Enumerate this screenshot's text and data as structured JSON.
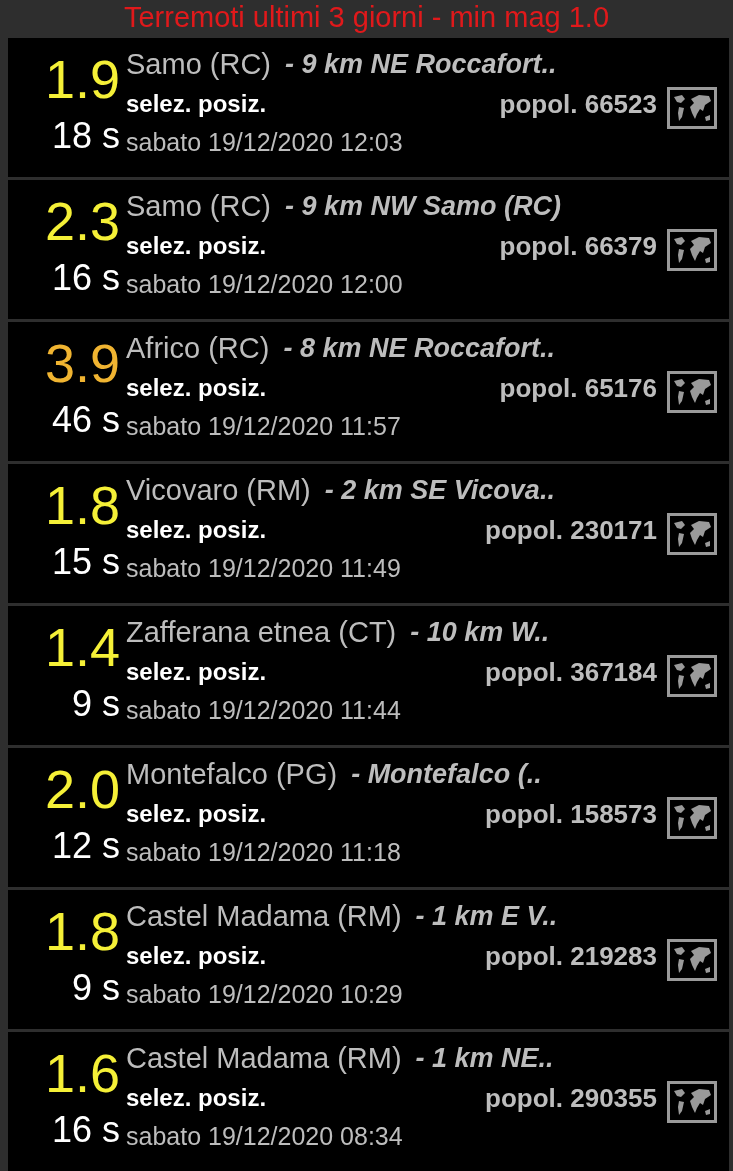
{
  "title": "Terremoti ultimi 3 giorni  - min mag 1.0",
  "rows": [
    {
      "magnitude": "1.9",
      "color": "#f5f037",
      "elapsed": "18 s",
      "place": "Samo (RC)",
      "distance": "- 9 km NE Roccafort..",
      "select": "selez. posiz.",
      "population": "popol. 66523",
      "date": "sabato 19/12/2020 12:03"
    },
    {
      "magnitude": "2.3",
      "color": "#f5f037",
      "elapsed": "16 s",
      "place": "Samo (RC)",
      "distance": "- 9 km NW Samo (RC)",
      "select": "selez. posiz.",
      "population": "popol. 66379",
      "date": "sabato 19/12/2020 12:00"
    },
    {
      "magnitude": "3.9",
      "color": "#f0b431",
      "elapsed": "46 s",
      "place": "Africo (RC)",
      "distance": "- 8 km NE Roccafort..",
      "select": "selez. posiz.",
      "population": "popol. 65176",
      "date": "sabato 19/12/2020 11:57"
    },
    {
      "magnitude": "1.8",
      "color": "#f5f037",
      "elapsed": "15 s",
      "place": "Vicovaro (RM)",
      "distance": "- 2 km SE Vicova..",
      "select": "selez. posiz.",
      "population": "popol. 230171",
      "date": "sabato 19/12/2020 11:49"
    },
    {
      "magnitude": "1.4",
      "color": "#f5f037",
      "elapsed": "9 s",
      "place": "Zafferana etnea (CT)",
      "distance": "- 10 km W..",
      "select": "selez. posiz.",
      "population": "popol. 367184",
      "date": "sabato 19/12/2020 11:44"
    },
    {
      "magnitude": "2.0",
      "color": "#f5f037",
      "elapsed": "12 s",
      "place": "Montefalco (PG)",
      "distance": "- Montefalco (..",
      "select": "selez. posiz.",
      "population": "popol. 158573",
      "date": "sabato 19/12/2020 11:18"
    },
    {
      "magnitude": "1.8",
      "color": "#f5f037",
      "elapsed": "9 s",
      "place": "Castel Madama (RM)",
      "distance": "- 1 km E V..",
      "select": "selez. posiz.",
      "population": "popol. 219283",
      "date": "sabato 19/12/2020 10:29"
    },
    {
      "magnitude": "1.6",
      "color": "#f5f037",
      "elapsed": "16 s",
      "place": "Castel Madama (RM)",
      "distance": "- 1 km NE..",
      "select": "selez. posiz.",
      "population": "popol. 290355",
      "date": "sabato 19/12/2020 08:34"
    }
  ]
}
